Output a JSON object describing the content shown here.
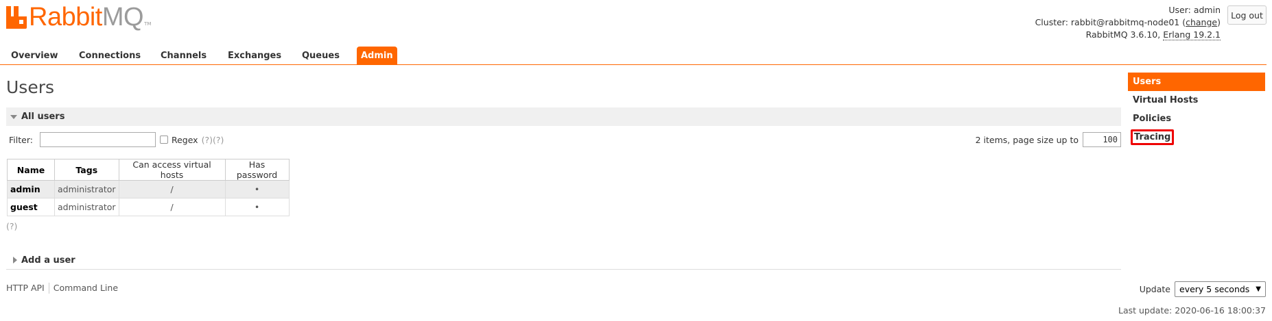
{
  "brand": {
    "rabbit": "Rabbit",
    "mq": "MQ",
    "tm": "TM",
    "color": "#ff6600"
  },
  "header": {
    "user_label": "User:",
    "user": "admin",
    "cluster_label": "Cluster:",
    "cluster": "rabbit@rabbitmq-node01",
    "change_link": "change",
    "version": "RabbitMQ 3.6.10,",
    "erlang": "Erlang 19.2.1",
    "logout": "Log out"
  },
  "tabs": [
    "Overview",
    "Connections",
    "Channels",
    "Exchanges",
    "Queues",
    "Admin"
  ],
  "active_tab": "Admin",
  "page_title": "Users",
  "all_users": {
    "title": "All users",
    "filter_label": "Filter:",
    "filter_value": "",
    "regex_label": "Regex",
    "help1": "(?)",
    "help2": "(?)",
    "pager_text": "2 items, page size up to",
    "page_size": "100",
    "columns": [
      "Name",
      "Tags",
      "Can access virtual hosts",
      "Has password"
    ],
    "rows": [
      {
        "name": "admin",
        "tags": "administrator",
        "vhosts": "/",
        "has_password": "•"
      },
      {
        "name": "guest",
        "tags": "administrator",
        "vhosts": "/",
        "has_password": "•"
      }
    ],
    "help_bottom": "(?)"
  },
  "add_user": {
    "title": "Add a user"
  },
  "footer": {
    "http_api": "HTTP API",
    "command_line": "Command Line"
  },
  "sidebar": {
    "items": [
      {
        "label": "Users",
        "active": true
      },
      {
        "label": "Virtual Hosts"
      },
      {
        "label": "Policies"
      },
      {
        "label": "Tracing",
        "highlighted": true
      }
    ]
  },
  "update": {
    "label": "Update",
    "value": "every 5 seconds",
    "last_update": "Last update: 2020-06-16 18:00:37"
  }
}
